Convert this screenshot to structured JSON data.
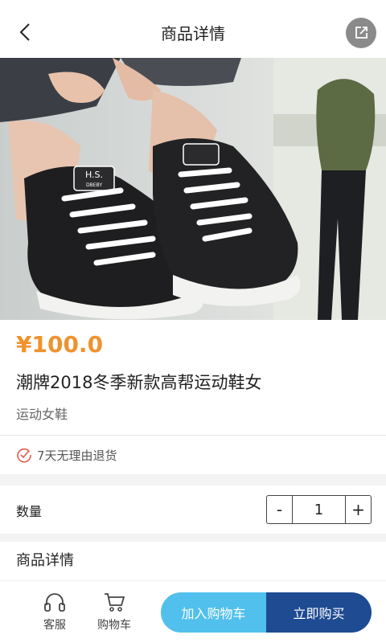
{
  "header": {
    "title": "商品详情",
    "back_icon": "chevron-left-icon",
    "share_icon": "share-icon"
  },
  "product": {
    "price": "¥100.0",
    "title": "潮牌2018冬季新款高帮运动鞋女",
    "subtitle": "运动女鞋",
    "guarantee": "7天无理由退货",
    "shoe_tag": "H.S.",
    "shoe_tag_sub": "DBEBY"
  },
  "quantity": {
    "label": "数量",
    "minus": "-",
    "value": "1",
    "plus": "+"
  },
  "details": {
    "title": "商品详情"
  },
  "bottom": {
    "service_label": "客服",
    "cart_label": "购物车",
    "add_to_cart": "加入购物车",
    "buy_now": "立即购买"
  },
  "colors": {
    "price": "#f0922c",
    "add_to_cart_bg": "#51c0ec",
    "buy_now_bg": "#1e4b92"
  }
}
